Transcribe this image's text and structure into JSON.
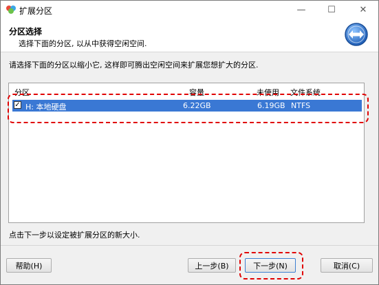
{
  "window": {
    "title": "扩展分区",
    "minimize": "—",
    "maximize": "☐",
    "close": "✕"
  },
  "header": {
    "title": "分区选择",
    "subtitle": "选择下面的分区, 以从中获得空闲空间."
  },
  "instruction": "请选择下面的分区以缩小它, 这样即可腾出空闲空间来扩展您想扩大的分区.",
  "table": {
    "columns": [
      "分区",
      "容量",
      "未使用",
      "文件系统"
    ],
    "rows": [
      {
        "checked": true,
        "partition": "H: 本地硬盘",
        "capacity": "6.22GB",
        "unused": "6.19GB",
        "filesystem": "NTFS"
      }
    ]
  },
  "note": "点击下一步以设定被扩展分区的新大小.",
  "buttons": {
    "help": "帮助(H)",
    "back": "上一步(B)",
    "next": "下一步(N)",
    "cancel": "取消(C)"
  },
  "colors": {
    "selection": "#3a78d4",
    "highlight": "#e00000"
  }
}
